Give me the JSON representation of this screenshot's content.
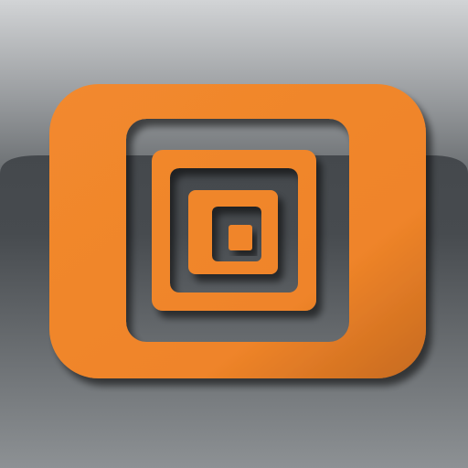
{
  "app_icon": {
    "icon": "concentric-squares-icon",
    "colors": {
      "orange": "#f0852a",
      "orange_dark": "#c86a1c",
      "background_dark": "#3a3e42",
      "background_light": "#b9bcbf",
      "gloss_top": "#d0d2d4"
    }
  }
}
